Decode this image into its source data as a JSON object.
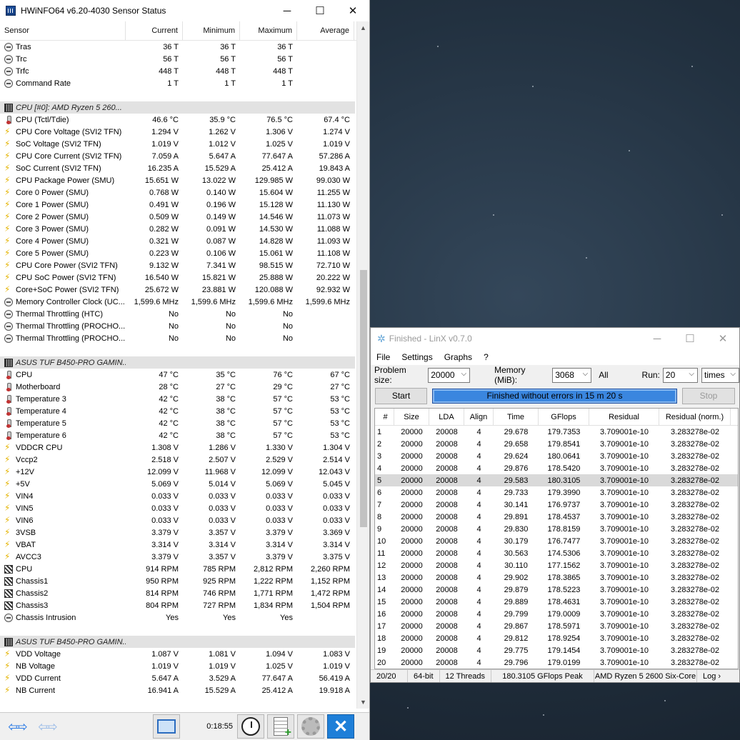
{
  "hwinfo": {
    "title": "HWiNFO64 v6.20-4030 Sensor Status",
    "window_controls": {
      "minimize": "─",
      "maximize": "☐",
      "close": "✕"
    },
    "columns": [
      "Sensor",
      "Current",
      "Minimum",
      "Maximum",
      "Average"
    ],
    "rows": [
      {
        "icon": "clock",
        "name": "Tras",
        "cur": "36 T",
        "min": "36 T",
        "max": "36 T",
        "avg": ""
      },
      {
        "icon": "clock",
        "name": "Trc",
        "cur": "56 T",
        "min": "56 T",
        "max": "56 T",
        "avg": ""
      },
      {
        "icon": "clock",
        "name": "Trfc",
        "cur": "448 T",
        "min": "448 T",
        "max": "448 T",
        "avg": ""
      },
      {
        "icon": "clock",
        "name": "Command Rate",
        "cur": "1 T",
        "min": "1 T",
        "max": "1 T",
        "avg": ""
      },
      {
        "type": "blank"
      },
      {
        "type": "group",
        "icon": "chip",
        "name": "CPU [#0]: AMD Ryzen 5 260..."
      },
      {
        "icon": "therm",
        "name": "CPU (Tctl/Tdie)",
        "cur": "46.6 °C",
        "min": "35.9 °C",
        "max": "76.5 °C",
        "avg": "67.4 °C"
      },
      {
        "icon": "volt",
        "name": "CPU Core Voltage (SVI2 TFN)",
        "cur": "1.294 V",
        "min": "1.262 V",
        "max": "1.306 V",
        "avg": "1.274 V"
      },
      {
        "icon": "volt",
        "name": "SoC Voltage (SVI2 TFN)",
        "cur": "1.019 V",
        "min": "1.012 V",
        "max": "1.025 V",
        "avg": "1.019 V"
      },
      {
        "icon": "volt",
        "name": "CPU Core Current (SVI2 TFN)",
        "cur": "7.059 A",
        "min": "5.647 A",
        "max": "77.647 A",
        "avg": "57.286 A"
      },
      {
        "icon": "volt",
        "name": "SoC Current (SVI2 TFN)",
        "cur": "16.235 A",
        "min": "15.529 A",
        "max": "25.412 A",
        "avg": "19.843 A"
      },
      {
        "icon": "volt",
        "name": "CPU Package Power (SMU)",
        "cur": "15.651 W",
        "min": "13.022 W",
        "max": "129.985 W",
        "avg": "99.030 W"
      },
      {
        "icon": "volt",
        "name": "Core 0 Power (SMU)",
        "cur": "0.768 W",
        "min": "0.140 W",
        "max": "15.604 W",
        "avg": "11.255 W"
      },
      {
        "icon": "volt",
        "name": "Core 1 Power (SMU)",
        "cur": "0.491 W",
        "min": "0.196 W",
        "max": "15.128 W",
        "avg": "11.130 W"
      },
      {
        "icon": "volt",
        "name": "Core 2 Power (SMU)",
        "cur": "0.509 W",
        "min": "0.149 W",
        "max": "14.546 W",
        "avg": "11.073 W"
      },
      {
        "icon": "volt",
        "name": "Core 3 Power (SMU)",
        "cur": "0.282 W",
        "min": "0.091 W",
        "max": "14.530 W",
        "avg": "11.088 W"
      },
      {
        "icon": "volt",
        "name": "Core 4 Power (SMU)",
        "cur": "0.321 W",
        "min": "0.087 W",
        "max": "14.828 W",
        "avg": "11.093 W"
      },
      {
        "icon": "volt",
        "name": "Core 5 Power (SMU)",
        "cur": "0.223 W",
        "min": "0.106 W",
        "max": "15.061 W",
        "avg": "11.108 W"
      },
      {
        "icon": "volt",
        "name": "CPU Core Power (SVI2 TFN)",
        "cur": "9.132 W",
        "min": "7.341 W",
        "max": "98.515 W",
        "avg": "72.710 W"
      },
      {
        "icon": "volt",
        "name": "CPU SoC Power (SVI2 TFN)",
        "cur": "16.540 W",
        "min": "15.821 W",
        "max": "25.888 W",
        "avg": "20.222 W"
      },
      {
        "icon": "volt",
        "name": "Core+SoC Power (SVI2 TFN)",
        "cur": "25.672 W",
        "min": "23.881 W",
        "max": "120.088 W",
        "avg": "92.932 W"
      },
      {
        "icon": "clock",
        "name": "Memory Controller Clock (UC...",
        "cur": "1,599.6 MHz",
        "min": "1,599.6 MHz",
        "max": "1,599.6 MHz",
        "avg": "1,599.6 MHz"
      },
      {
        "icon": "clock",
        "name": "Thermal Throttling (HTC)",
        "cur": "No",
        "min": "No",
        "max": "No",
        "avg": ""
      },
      {
        "icon": "clock",
        "name": "Thermal Throttling (PROCHO...",
        "cur": "No",
        "min": "No",
        "max": "No",
        "avg": ""
      },
      {
        "icon": "clock",
        "name": "Thermal Throttling (PROCHO...",
        "cur": "No",
        "min": "No",
        "max": "No",
        "avg": ""
      },
      {
        "type": "blank"
      },
      {
        "type": "group",
        "icon": "chip",
        "name": "ASUS TUF B450-PRO GAMIN..."
      },
      {
        "icon": "therm",
        "name": "CPU",
        "cur": "47 °C",
        "min": "35 °C",
        "max": "76 °C",
        "avg": "67 °C"
      },
      {
        "icon": "therm",
        "name": "Motherboard",
        "cur": "28 °C",
        "min": "27 °C",
        "max": "29 °C",
        "avg": "27 °C"
      },
      {
        "icon": "therm",
        "name": "Temperature 3",
        "cur": "42 °C",
        "min": "38 °C",
        "max": "57 °C",
        "avg": "53 °C"
      },
      {
        "icon": "therm",
        "name": "Temperature 4",
        "cur": "42 °C",
        "min": "38 °C",
        "max": "57 °C",
        "avg": "53 °C"
      },
      {
        "icon": "therm",
        "name": "Temperature 5",
        "cur": "42 °C",
        "min": "38 °C",
        "max": "57 °C",
        "avg": "53 °C"
      },
      {
        "icon": "therm",
        "name": "Temperature 6",
        "cur": "42 °C",
        "min": "38 °C",
        "max": "57 °C",
        "avg": "53 °C"
      },
      {
        "icon": "volt",
        "name": "VDDCR CPU",
        "cur": "1.308 V",
        "min": "1.286 V",
        "max": "1.330 V",
        "avg": "1.304 V"
      },
      {
        "icon": "volt",
        "name": "Vccp2",
        "cur": "2.518 V",
        "min": "2.507 V",
        "max": "2.529 V",
        "avg": "2.514 V"
      },
      {
        "icon": "volt",
        "name": "+12V",
        "cur": "12.099 V",
        "min": "11.968 V",
        "max": "12.099 V",
        "avg": "12.043 V"
      },
      {
        "icon": "volt",
        "name": "+5V",
        "cur": "5.069 V",
        "min": "5.014 V",
        "max": "5.069 V",
        "avg": "5.045 V"
      },
      {
        "icon": "volt",
        "name": "VIN4",
        "cur": "0.033 V",
        "min": "0.033 V",
        "max": "0.033 V",
        "avg": "0.033 V"
      },
      {
        "icon": "volt",
        "name": "VIN5",
        "cur": "0.033 V",
        "min": "0.033 V",
        "max": "0.033 V",
        "avg": "0.033 V"
      },
      {
        "icon": "volt",
        "name": "VIN6",
        "cur": "0.033 V",
        "min": "0.033 V",
        "max": "0.033 V",
        "avg": "0.033 V"
      },
      {
        "icon": "volt",
        "name": "3VSB",
        "cur": "3.379 V",
        "min": "3.357 V",
        "max": "3.379 V",
        "avg": "3.369 V"
      },
      {
        "icon": "volt",
        "name": "VBAT",
        "cur": "3.314 V",
        "min": "3.314 V",
        "max": "3.314 V",
        "avg": "3.314 V"
      },
      {
        "icon": "volt",
        "name": "AVCC3",
        "cur": "3.379 V",
        "min": "3.357 V",
        "max": "3.379 V",
        "avg": "3.375 V"
      },
      {
        "icon": "fan",
        "name": "CPU",
        "cur": "914 RPM",
        "min": "785 RPM",
        "max": "2,812 RPM",
        "avg": "2,260 RPM"
      },
      {
        "icon": "fan",
        "name": "Chassis1",
        "cur": "950 RPM",
        "min": "925 RPM",
        "max": "1,222 RPM",
        "avg": "1,152 RPM"
      },
      {
        "icon": "fan",
        "name": "Chassis2",
        "cur": "814 RPM",
        "min": "746 RPM",
        "max": "1,771 RPM",
        "avg": "1,472 RPM"
      },
      {
        "icon": "fan",
        "name": "Chassis3",
        "cur": "804 RPM",
        "min": "727 RPM",
        "max": "1,834 RPM",
        "avg": "1,504 RPM"
      },
      {
        "icon": "clock",
        "name": "Chassis Intrusion",
        "cur": "Yes",
        "min": "Yes",
        "max": "Yes",
        "avg": ""
      },
      {
        "type": "blank"
      },
      {
        "type": "group",
        "icon": "chip",
        "name": "ASUS TUF B450-PRO GAMIN..."
      },
      {
        "icon": "volt",
        "name": "VDD Voltage",
        "cur": "1.087 V",
        "min": "1.081 V",
        "max": "1.094 V",
        "avg": "1.083 V"
      },
      {
        "icon": "volt",
        "name": "NB Voltage",
        "cur": "1.019 V",
        "min": "1.019 V",
        "max": "1.025 V",
        "avg": "1.019 V"
      },
      {
        "icon": "volt",
        "name": "VDD Current",
        "cur": "5.647 A",
        "min": "3.529 A",
        "max": "77.647 A",
        "avg": "56.419 A"
      },
      {
        "icon": "volt",
        "name": "NB Current",
        "cur": "16.941 A",
        "min": "15.529 A",
        "max": "25.412 A",
        "avg": "19.918 A"
      }
    ],
    "toolbar": {
      "elapsed": "0:18:55"
    },
    "colors": {
      "accent": "#1e7fd8"
    }
  },
  "linx": {
    "title": "Finished - LinX v0.7.0",
    "menu": [
      "File",
      "Settings",
      "Graphs",
      "?"
    ],
    "problem_size_label": "Problem size:",
    "problem_size": "20000",
    "memory_label": "Memory (MiB):",
    "memory": "3068",
    "all_label": "All",
    "run_label": "Run:",
    "run": "20",
    "run_unit": "times",
    "start_label": "Start",
    "stop_label": "Stop",
    "progress_text": "Finished without errors in 15 m 20 s",
    "progress_fraction": 1.0,
    "columns": [
      "#",
      "Size",
      "LDA",
      "Align",
      "Time",
      "GFlops",
      "Residual",
      "Residual (norm.)"
    ],
    "selected_row": 5,
    "rows": [
      [
        "1",
        "20000",
        "20008",
        "4",
        "29.678",
        "179.7353",
        "3.709001e-10",
        "3.283278e-02"
      ],
      [
        "2",
        "20000",
        "20008",
        "4",
        "29.658",
        "179.8541",
        "3.709001e-10",
        "3.283278e-02"
      ],
      [
        "3",
        "20000",
        "20008",
        "4",
        "29.624",
        "180.0641",
        "3.709001e-10",
        "3.283278e-02"
      ],
      [
        "4",
        "20000",
        "20008",
        "4",
        "29.876",
        "178.5420",
        "3.709001e-10",
        "3.283278e-02"
      ],
      [
        "5",
        "20000",
        "20008",
        "4",
        "29.583",
        "180.3105",
        "3.709001e-10",
        "3.283278e-02"
      ],
      [
        "6",
        "20000",
        "20008",
        "4",
        "29.733",
        "179.3990",
        "3.709001e-10",
        "3.283278e-02"
      ],
      [
        "7",
        "20000",
        "20008",
        "4",
        "30.141",
        "176.9737",
        "3.709001e-10",
        "3.283278e-02"
      ],
      [
        "8",
        "20000",
        "20008",
        "4",
        "29.891",
        "178.4537",
        "3.709001e-10",
        "3.283278e-02"
      ],
      [
        "9",
        "20000",
        "20008",
        "4",
        "29.830",
        "178.8159",
        "3.709001e-10",
        "3.283278e-02"
      ],
      [
        "10",
        "20000",
        "20008",
        "4",
        "30.179",
        "176.7477",
        "3.709001e-10",
        "3.283278e-02"
      ],
      [
        "11",
        "20000",
        "20008",
        "4",
        "30.563",
        "174.5306",
        "3.709001e-10",
        "3.283278e-02"
      ],
      [
        "12",
        "20000",
        "20008",
        "4",
        "30.110",
        "177.1562",
        "3.709001e-10",
        "3.283278e-02"
      ],
      [
        "13",
        "20000",
        "20008",
        "4",
        "29.902",
        "178.3865",
        "3.709001e-10",
        "3.283278e-02"
      ],
      [
        "14",
        "20000",
        "20008",
        "4",
        "29.879",
        "178.5223",
        "3.709001e-10",
        "3.283278e-02"
      ],
      [
        "15",
        "20000",
        "20008",
        "4",
        "29.889",
        "178.4631",
        "3.709001e-10",
        "3.283278e-02"
      ],
      [
        "16",
        "20000",
        "20008",
        "4",
        "29.799",
        "179.0009",
        "3.709001e-10",
        "3.283278e-02"
      ],
      [
        "17",
        "20000",
        "20008",
        "4",
        "29.867",
        "178.5971",
        "3.709001e-10",
        "3.283278e-02"
      ],
      [
        "18",
        "20000",
        "20008",
        "4",
        "29.812",
        "178.9254",
        "3.709001e-10",
        "3.283278e-02"
      ],
      [
        "19",
        "20000",
        "20008",
        "4",
        "29.775",
        "179.1454",
        "3.709001e-10",
        "3.283278e-02"
      ],
      [
        "20",
        "20000",
        "20008",
        "4",
        "29.796",
        "179.0199",
        "3.709001e-10",
        "3.283278e-02"
      ]
    ],
    "status": [
      "20/20",
      "64-bit",
      "12 Threads",
      "180.3105 GFlops Peak",
      "AMD Ryzen 5 2600 Six-Core",
      "Log ›"
    ]
  }
}
